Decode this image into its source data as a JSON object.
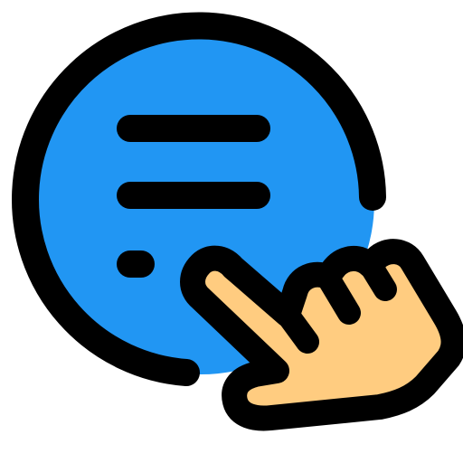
{
  "icon": {
    "name": "chat-bubble-tap-icon",
    "parts": [
      "chat-bubble-icon",
      "menu-lines-icon",
      "pointing-hand-icon"
    ]
  },
  "colors": {
    "outline": "#000000",
    "bubble_fill": "#2196f3",
    "hand_fill": "#ffcc80",
    "background": "#ffffff"
  }
}
